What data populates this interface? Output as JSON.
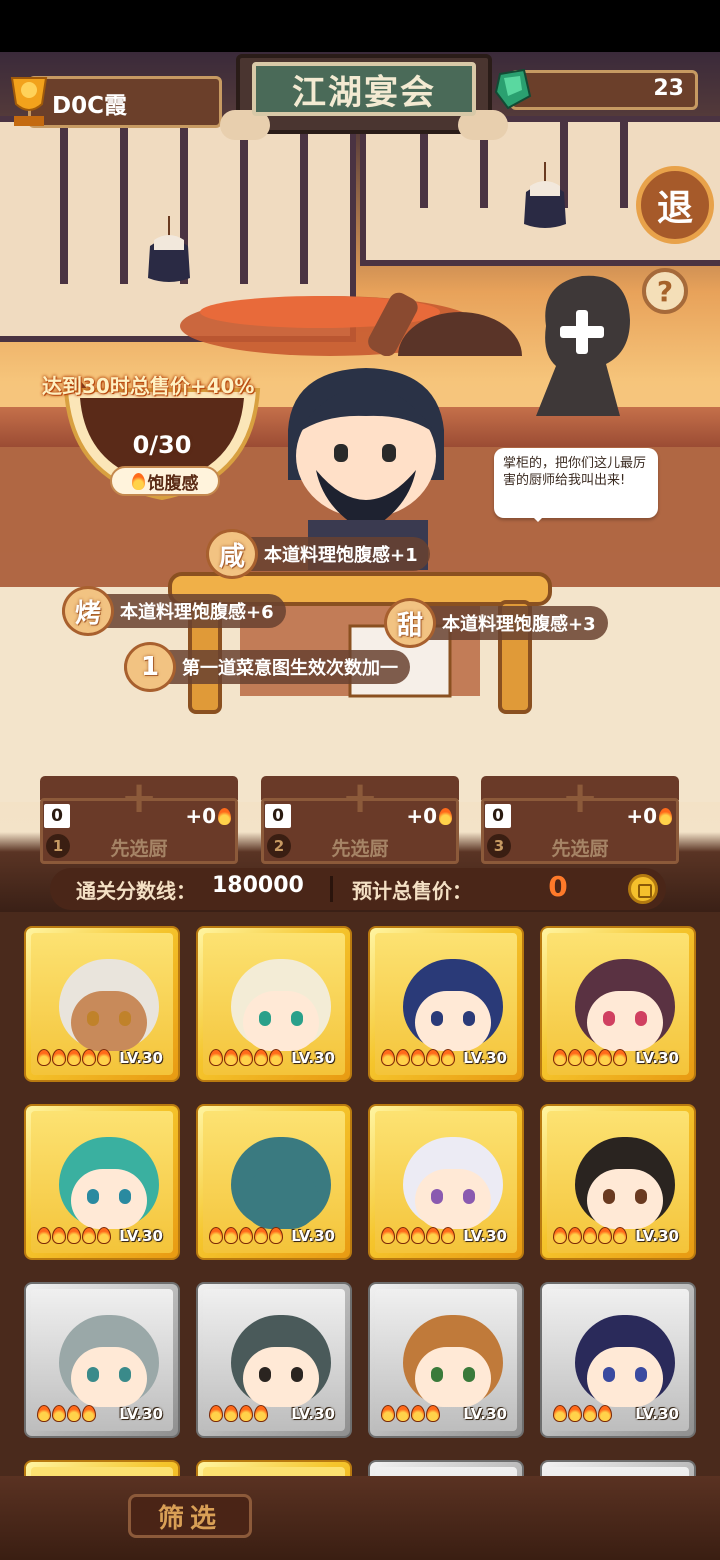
{
  "top": {
    "player_name": "D0C霞",
    "event_title": "江湖宴会",
    "gems": "23",
    "exit_label": "退",
    "help_label": "?"
  },
  "bowl": {
    "tip": "达到30时总售价+40%",
    "progress": "0/30",
    "label": "饱腹感"
  },
  "speech": "掌柜的，把你们这儿最厉害的厨师给我叫出来!",
  "buffs": [
    {
      "icon": "咸",
      "text": "本道料理饱腹感+1"
    },
    {
      "icon": "烤",
      "text": "本道料理饱腹感+6"
    },
    {
      "icon": "甜",
      "text": "本道料理饱腹感+3"
    },
    {
      "icon": "1",
      "text": "第一道菜意图生效次数加一"
    }
  ],
  "slots": [
    {
      "num": "1",
      "count": "0",
      "bonus": "+0",
      "label": "先选厨"
    },
    {
      "num": "2",
      "count": "0",
      "bonus": "+0",
      "label": "先选厨"
    },
    {
      "num": "3",
      "count": "0",
      "bonus": "+0",
      "label": "先选厨"
    }
  ],
  "score": {
    "threshold_label": "通关分数线：",
    "threshold_value": "180000",
    "price_label": "预计总售价：",
    "price_value": "0"
  },
  "roster": [
    {
      "level": "LV.30",
      "tier": "gold",
      "stars": 5,
      "hair": "#e9e4dc",
      "eye": "#c0822a",
      "skin": "#c88a5a"
    },
    {
      "level": "LV.30",
      "tier": "gold",
      "stars": 5,
      "hair": "#f3ecd6",
      "eye": "#2aa08a",
      "skin": "#ffe9d6"
    },
    {
      "level": "LV.30",
      "tier": "gold",
      "stars": 5,
      "hair": "#2a3a78",
      "eye": "#2a3a78",
      "skin": "#ffe9d6"
    },
    {
      "level": "LV.30",
      "tier": "gold",
      "stars": 5,
      "hair": "#5a3242",
      "eye": "#d04060",
      "skin": "#ffe9d6"
    },
    {
      "level": "LV.30",
      "tier": "gold",
      "stars": 5,
      "hair": "#3ab0a0",
      "eye": "#2a8aa0",
      "skin": "#ffe9d6"
    },
    {
      "level": "LV.30",
      "tier": "gold",
      "stars": 5,
      "hair": "#3a7a80",
      "eye": "#3a7a80",
      "skin": "#3a7a80"
    },
    {
      "level": "LV.30",
      "tier": "gold",
      "stars": 5,
      "hair": "#ecebf4",
      "eye": "#8a5ab0",
      "skin": "#ffe9d6"
    },
    {
      "level": "LV.30",
      "tier": "gold",
      "stars": 5,
      "hair": "#2a2420",
      "eye": "#6a3a20",
      "skin": "#ffe9d6"
    },
    {
      "level": "LV.30",
      "tier": "silver",
      "stars": 4,
      "hair": "#9aa8a8",
      "eye": "#3a8a8a",
      "skin": "#ffe9d6"
    },
    {
      "level": "LV.30",
      "tier": "silver",
      "stars": 4,
      "hair": "#4a5a5a",
      "eye": "#2a2420",
      "skin": "#ffe9d6"
    },
    {
      "level": "LV.30",
      "tier": "silver",
      "stars": 4,
      "hair": "#c07a3a",
      "eye": "#3a7a3a",
      "skin": "#ffe9d6"
    },
    {
      "level": "LV.30",
      "tier": "silver",
      "stars": 4,
      "hair": "#2a2a5a",
      "eye": "#3a4aa0",
      "skin": "#ffe9d6"
    }
  ],
  "filter_label": "筛选",
  "colors": {
    "accent_orange": "#ff7a2a",
    "wood_dark": "#4a2a1c",
    "gold_card": "#f5c52c",
    "silver_card": "#b7b7b7"
  }
}
